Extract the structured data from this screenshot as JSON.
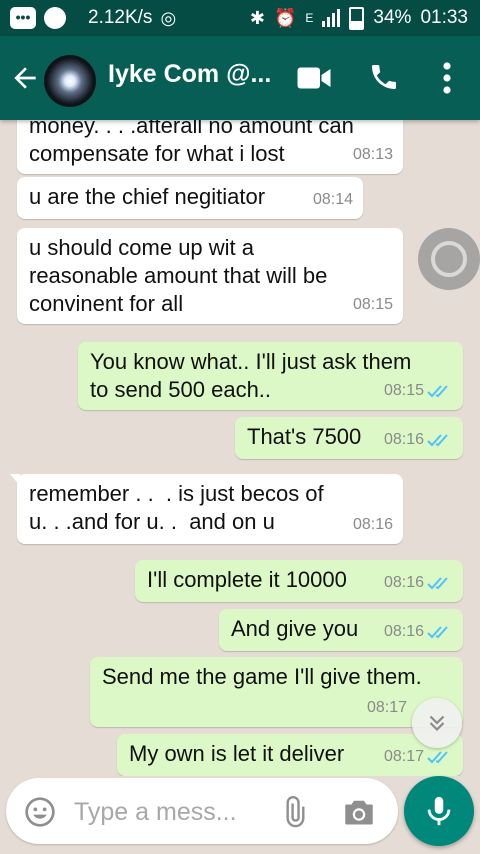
{
  "status_bar": {
    "speed": "2.12K/s",
    "battery": "34%",
    "time": "01:33",
    "network": "E"
  },
  "header": {
    "contact_name": "Iyke Com @..."
  },
  "messages": [
    {
      "type": "in",
      "text": "money. . . .afterall no amount can\ncompensate for what i lost",
      "time": "08:13"
    },
    {
      "type": "in",
      "text": "u are the chief negitiator",
      "time": "08:14"
    },
    {
      "type": "in",
      "text": "u should come up wit a\nreasonable amount that will be\nconvinent for all",
      "time": "08:15"
    },
    {
      "type": "out",
      "text": "You know what.. I'll just ask them\nto send 500 each..",
      "time": "08:15"
    },
    {
      "type": "out",
      "text": "That's 7500",
      "time": "08:16"
    },
    {
      "type": "in",
      "text": "remember . .  . is just becos of\nu. . .and for u. .  and on u",
      "time": "08:16"
    },
    {
      "type": "out",
      "text": "I'll complete it 10000",
      "time": "08:16"
    },
    {
      "type": "out",
      "text": "And give you",
      "time": "08:16"
    },
    {
      "type": "out",
      "text": "Send me the game I'll give them.",
      "time": "08:17"
    },
    {
      "type": "out",
      "text": "My own is let it deliver",
      "time": "08:17"
    }
  ],
  "input": {
    "placeholder": "Type a mess..."
  },
  "icons": {
    "back": "back-arrow-icon",
    "video": "video-call-icon",
    "call": "phone-icon",
    "menu": "more-vertical-icon",
    "emoji": "emoji-icon",
    "attach": "paperclip-icon",
    "camera": "camera-icon",
    "mic": "microphone-icon",
    "scroll_down": "chevron-double-down-icon"
  },
  "colors": {
    "header": "#075e54",
    "status_bar": "#054d44",
    "outgoing_bubble": "#dcf8c6",
    "incoming_bubble": "#ffffff",
    "read_ticks": "#4fc3f7",
    "mic_button": "#00897b"
  }
}
